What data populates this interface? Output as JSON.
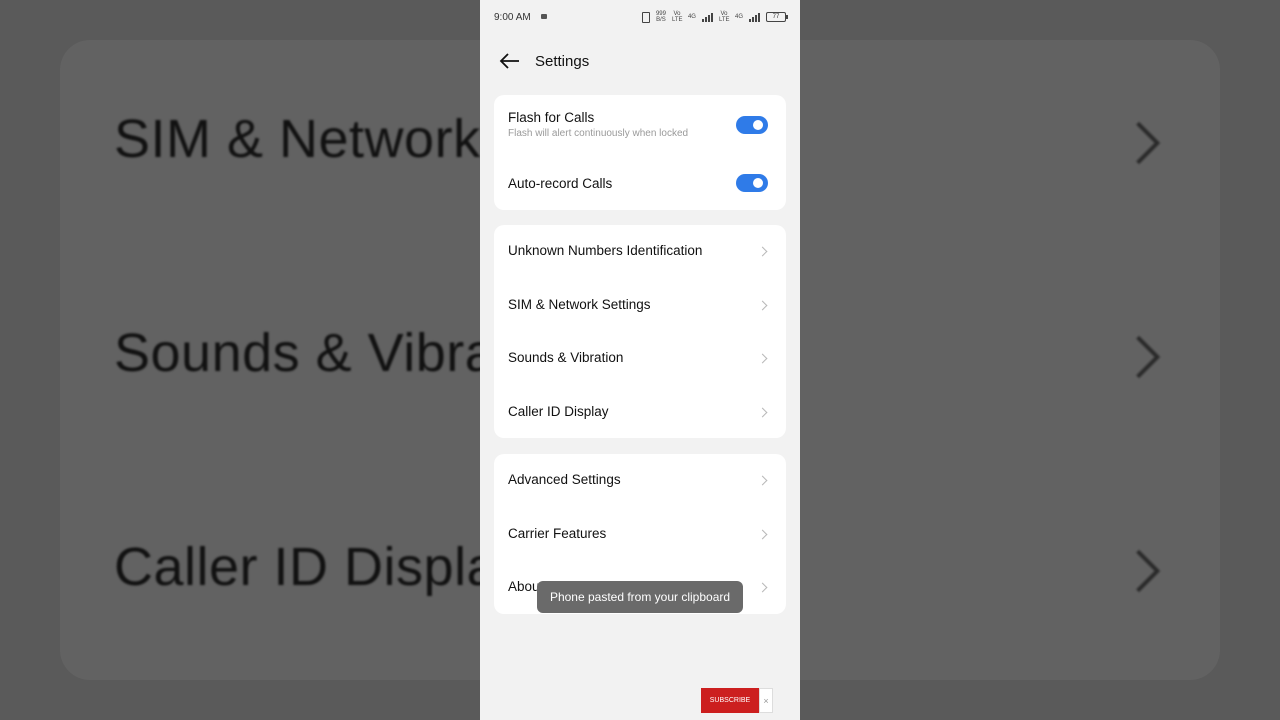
{
  "background": {
    "items": [
      "SIM & Network",
      "Sounds & Vibra",
      "Caller ID Displa"
    ]
  },
  "status_bar": {
    "time": "9:00 AM",
    "speed_value": "999",
    "speed_unit": "B/S",
    "sim1_volte": "Vo LTE",
    "sim1_network": "4G",
    "sim2_volte": "Vo LTE",
    "sim2_network": "4G",
    "battery": "77"
  },
  "header": {
    "title": "Settings"
  },
  "toggles_card": {
    "flash_for_calls": {
      "label": "Flash for Calls",
      "subtitle": "Flash will alert continuously when locked",
      "on": true
    },
    "auto_record_calls": {
      "label": "Auto-record Calls",
      "on": true
    }
  },
  "menu_card_1": {
    "items": [
      "Unknown Numbers Identification",
      "SIM & Network Settings",
      "Sounds & Vibration",
      "Caller ID Display"
    ]
  },
  "menu_card_2": {
    "items": [
      "Advanced Settings",
      "Carrier Features",
      "About"
    ]
  },
  "toast": {
    "message": "Phone pasted from your clipboard"
  },
  "overlay": {
    "subscribe_label": "SUBSCRIBE",
    "close_label": "×"
  },
  "colors": {
    "accent": "#2f7be8",
    "subscribe_red": "#cc1f1f"
  }
}
